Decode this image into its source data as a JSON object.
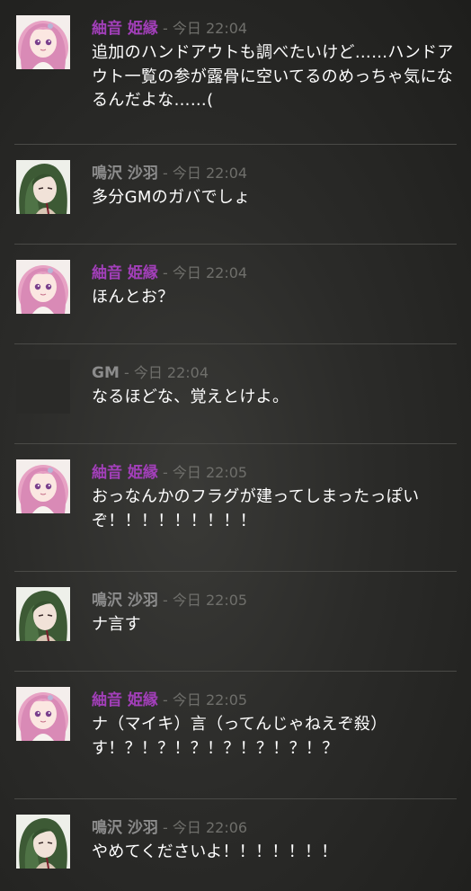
{
  "messages": [
    {
      "name": "紬音 姫縁",
      "dash": "-",
      "time": "今日 22:04",
      "text": "追加のハンドアウトも調べたいけど……ハンドアウト一覧の参が露骨に空いてるのめっちゃ気になるんだよな……("
    },
    {
      "name": "鳴沢 沙羽",
      "dash": "-",
      "time": "今日 22:04",
      "text": "多分GMのガバでしょ"
    },
    {
      "name": "紬音 姫縁",
      "dash": "-",
      "time": "今日 22:04",
      "text": "ほんとお？"
    },
    {
      "name": "GM",
      "dash": "-",
      "time": "今日 22:04",
      "text": "なるほどな、覚えとけよ。"
    },
    {
      "name": "紬音 姫縁",
      "dash": "-",
      "time": "今日 22:05",
      "text": "おっなんかのフラグが建ってしまったっぽいぞ！！！！！！！！！"
    },
    {
      "name": "鳴沢 沙羽",
      "dash": "-",
      "time": "今日 22:05",
      "text": "ナ言す"
    },
    {
      "name": "紬音 姫縁",
      "dash": "-",
      "time": "今日 22:05",
      "text": "ナ（マイキ）言（ってんじゃねえぞ殺）す！？！？！？！？！？！？！？"
    },
    {
      "name": "鳴沢 沙羽",
      "dash": "-",
      "time": "今日 22:06",
      "text": "やめてくださいよ！！！！！！！"
    }
  ],
  "colors": {
    "himeyori": "#a23fb9",
    "default_name": "#8c8c8c",
    "meta": "#6f6f6b"
  },
  "avatars": {
    "himeyori": "pink-haired-girl-avatar",
    "saha": "green-haired-girl-avatar",
    "gm": "blank-dark-avatar"
  }
}
